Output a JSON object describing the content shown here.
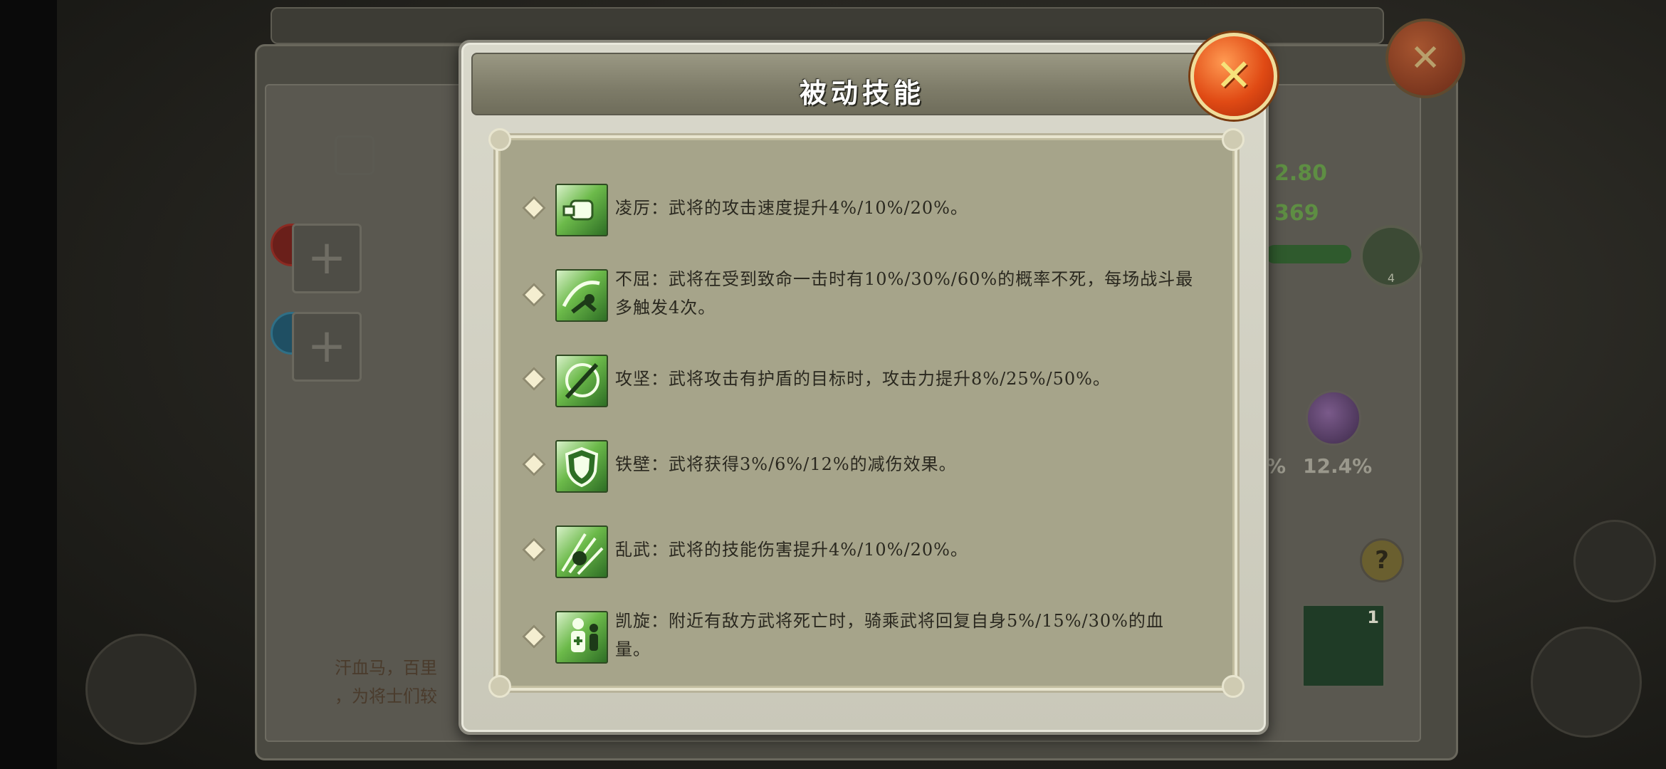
{
  "dialog": {
    "title": "被动技能",
    "close_glyph": "✕"
  },
  "skills": [
    {
      "icon": "fist-icon",
      "text": "凌厉：武将的攻击速度提升4%/10%/20%。"
    },
    {
      "icon": "dodge-figure-icon",
      "text": "不屈：武将在受到致命一击时有10%/30%/60%的概率不死，每场战斗最多触发4次。"
    },
    {
      "icon": "slash-icon",
      "text": "攻坚：武将攻击有护盾的目标时，攻击力提升8%/25%/50%。"
    },
    {
      "icon": "shield-icon",
      "text": "铁壁：武将获得3%/6%/12%的减伤效果。"
    },
    {
      "icon": "burst-icon",
      "text": "乱武：武将的技能伤害提升4%/10%/20%。"
    },
    {
      "icon": "heal-figure-icon",
      "text": "凯旋：附近有敌方武将死亡时，骑乘武将回复自身5%/15%/30%的血量。"
    }
  ],
  "background": {
    "stat_1": "2.80",
    "stat_2": "369",
    "level_badge": "4",
    "pct_partial": "%",
    "pct_value": "12.4%",
    "help_glyph": "?",
    "item_count": "1",
    "desc_line_1": "汗血马，百里",
    "desc_line_2": "，为将士们较"
  },
  "colors": {
    "accent_green": "#5cae3a",
    "close_orange": "#e04a14",
    "panel_tan": "#a6a48a"
  }
}
